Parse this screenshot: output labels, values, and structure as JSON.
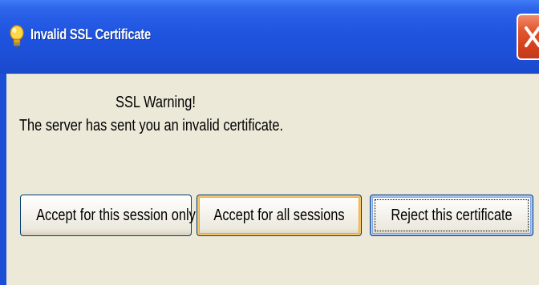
{
  "window": {
    "title": "Invalid SSL Certificate"
  },
  "message": {
    "heading": "SSL Warning!",
    "body": "The server has sent you an invalid certificate."
  },
  "buttons": {
    "accept_session": "Accept for this session only",
    "accept_all": "Accept for all sessions",
    "reject": "Reject this certificate"
  },
  "icons": {
    "title": "app-lightbulb-icon",
    "close": "close-x-icon"
  },
  "colors": {
    "titlebar": "#1f54df",
    "client_background": "#ece9d8",
    "close_button": "#d9441e"
  }
}
